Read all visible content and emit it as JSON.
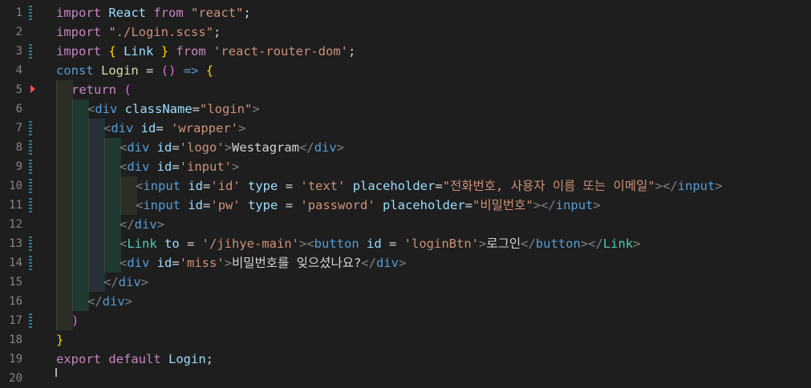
{
  "editor": {
    "line_numbers": [
      "1",
      "2",
      "3",
      "4",
      "5",
      "6",
      "7",
      "8",
      "9",
      "10",
      "11",
      "12",
      "13",
      "14",
      "15",
      "16",
      "17",
      "18",
      "19",
      "20"
    ],
    "lines": {
      "l1": [
        "import",
        " React ",
        "from",
        " \"react\"",
        ";"
      ],
      "l2": [
        "import",
        " \"./Login.scss\"",
        ";"
      ],
      "l3": [
        "import",
        " ",
        "{",
        " Link ",
        "}",
        " ",
        "from",
        " 'react-router-dom'",
        ";"
      ],
      "l4": [
        "const",
        " Login ",
        "=",
        " ",
        "()",
        " ",
        "=>",
        " ",
        "{"
      ],
      "l5": [
        "return",
        " ",
        "("
      ],
      "l6": [
        "<",
        "div",
        " className",
        "=",
        "\"login\"",
        ">"
      ],
      "l7": [
        "<",
        "div",
        " id",
        "=",
        " 'wrapper'",
        ">"
      ],
      "l8": [
        "<",
        "div",
        " id",
        "=",
        "'logo'",
        ">",
        "Westagram",
        "</",
        "div",
        ">"
      ],
      "l9": [
        "<",
        "div",
        " id",
        "=",
        "'input'",
        ">"
      ],
      "l10": [
        "<",
        "input",
        " id",
        "=",
        "'id'",
        " type",
        " = ",
        "'text'",
        " placeholder",
        "=",
        "\"전화번호, 사용자 이름 또는 이메일\"",
        "></",
        "input",
        ">"
      ],
      "l11": [
        "<",
        "input",
        " id",
        "=",
        "'pw'",
        " type",
        " = ",
        "'password'",
        " placeholder",
        "=",
        "\"비밀번호\"",
        "></",
        "input",
        ">"
      ],
      "l12": [
        "</",
        "div",
        ">"
      ],
      "l13": [
        "<",
        "Link",
        " to",
        " = ",
        "'/jihye-main'",
        "><",
        "button",
        " id",
        " = ",
        "'loginBtn'",
        ">",
        "로그인",
        "</",
        "button",
        "></",
        "Link",
        ">"
      ],
      "l14": [
        "<",
        "div",
        " id",
        "=",
        "'miss'",
        ">",
        "비밀번호를 잊으셨나요?",
        "</",
        "div",
        ">"
      ],
      "l15": [
        "</",
        "div",
        ">"
      ],
      "l16": [
        "</",
        "div",
        ">"
      ],
      "l17": [
        ")"
      ],
      "l18": [
        "}"
      ],
      "l19": [
        "export",
        " ",
        "default",
        " Login",
        ";"
      ]
    }
  },
  "colors": {
    "background": "#1e1e1e",
    "keyword": "#c586c0",
    "string": "#ce9178",
    "tag": "#569cd6",
    "attribute": "#9cdcfe",
    "component": "#4ec9b0",
    "gutter_modified": "#1b81a8",
    "gutter_deleted": "#f14c4c"
  }
}
